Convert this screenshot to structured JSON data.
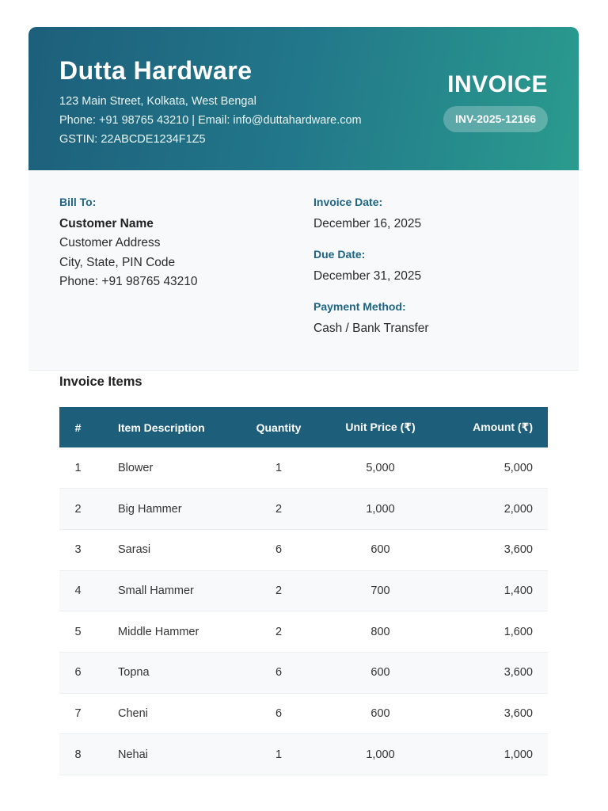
{
  "company": {
    "name": "Dutta Hardware",
    "address": "123 Main Street, Kolkata, West Bengal",
    "contact": "Phone: +91 98765 43210 | Email: info@duttahardware.com",
    "gstin": "GSTIN: 22ABCDE1234F1Z5"
  },
  "invoice": {
    "title": "INVOICE",
    "number": "INV-2025-12166"
  },
  "bill_to": {
    "label": "Bill To:",
    "name": "Customer Name",
    "address": "Customer Address",
    "city": "City, State, PIN Code",
    "phone": "Phone: +91 98765 43210"
  },
  "details": {
    "invoice_date_label": "Invoice Date:",
    "invoice_date": "December 16, 2025",
    "due_date_label": "Due Date:",
    "due_date": "December 31, 2025",
    "payment_method_label": "Payment Method:",
    "payment_method": "Cash / Bank Transfer"
  },
  "items": {
    "title": "Invoice Items",
    "columns": [
      "#",
      "Item Description",
      "Quantity",
      "Unit Price (₹)",
      "Amount (₹)"
    ],
    "rows": [
      [
        "1",
        "Blower",
        "1",
        "5,000",
        "5,000"
      ],
      [
        "2",
        "Big Hammer",
        "2",
        "1,000",
        "2,000"
      ],
      [
        "3",
        "Sarasi",
        "6",
        "600",
        "3,600"
      ],
      [
        "4",
        "Small Hammer",
        "2",
        "700",
        "1,400"
      ],
      [
        "5",
        "Middle Hammer",
        "2",
        "800",
        "1,600"
      ],
      [
        "6",
        "Topna",
        "6",
        "600",
        "3,600"
      ],
      [
        "7",
        "Cheni",
        "6",
        "600",
        "3,600"
      ],
      [
        "8",
        "Nehai",
        "1",
        "1,000",
        "1,000"
      ]
    ]
  },
  "colors": {
    "primary": "#1d5f7b",
    "accent": "#2a9b8e",
    "label": "#1e6483",
    "stripe": "#f7f9fb"
  }
}
